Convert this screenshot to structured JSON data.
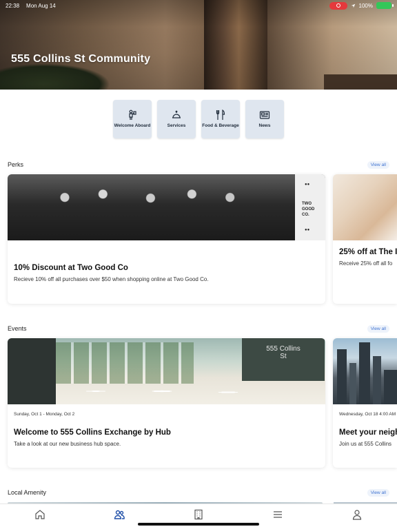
{
  "status_bar": {
    "time": "22:38",
    "date": "Mon Aug 14",
    "battery": "100%"
  },
  "header": {
    "title": "555 Collins St Community"
  },
  "quick_actions": [
    {
      "label": "Welcome Aboard",
      "icon": "welcome-icon"
    },
    {
      "label": "Services",
      "icon": "bell-icon"
    },
    {
      "label": "Food & Beverage",
      "icon": "utensils-icon"
    },
    {
      "label": "News",
      "icon": "newspaper-icon"
    }
  ],
  "sections": {
    "perks": {
      "title": "Perks",
      "view_all": "View all",
      "cards": [
        {
          "title": "10% Discount at Two Good Co",
          "description": "Recieve 10% off all purchases over $50 when shopping online at Two Good Co.",
          "image_text": [
            "TWO",
            "GOOD",
            "CO."
          ]
        },
        {
          "title": "25% off at The I",
          "description": "Receive 25% off all fo"
        }
      ]
    },
    "events": {
      "title": "Events",
      "view_all": "View all",
      "cards": [
        {
          "date": "Sunday, Oct 1 - Monday, Oct 2",
          "title": "Welcome to 555 Collins Exchange by Hub",
          "description": "Take a look at our new business hub space.",
          "image_text": "555 Collins St"
        },
        {
          "date": "Wednesday, Oct 18 4:00 AM",
          "title": "Meet your neigh",
          "description": "Join us at 555 Collins"
        }
      ]
    },
    "local_amenity": {
      "title": "Local Amenity",
      "view_all": "View all"
    }
  },
  "tabbar": [
    {
      "icon": "home-icon"
    },
    {
      "icon": "community-icon"
    },
    {
      "icon": "building-icon"
    },
    {
      "icon": "menu-icon"
    },
    {
      "icon": "profile-icon"
    }
  ],
  "colors": {
    "accent": "#3f73d1",
    "tile_bg": "#dfe6ef",
    "active_tab": "#1f4fa8"
  }
}
